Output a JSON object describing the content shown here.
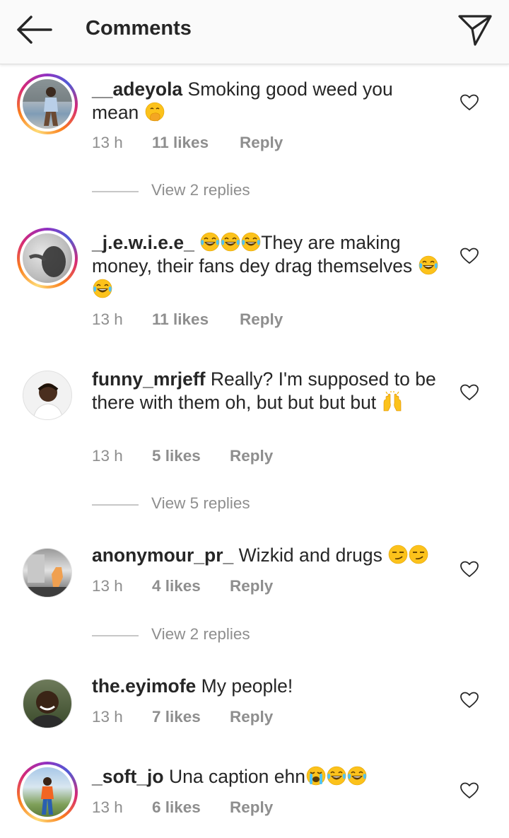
{
  "header": {
    "title": "Comments",
    "back_icon": "arrow-left-icon",
    "direct_icon": "paper-plane-icon"
  },
  "comments": [
    {
      "username": "__adeyola",
      "text": "Smoking good weed you mean",
      "emojis": [
        "face-with-hand-over-mouth"
      ],
      "time": "13 h",
      "likes": "11 likes",
      "reply": "Reply",
      "view_replies": "View 2 replies",
      "story_ring": true
    },
    {
      "username": "_j.e.w.i.e.e_",
      "text_before": "They are making money, their fans dey drag themselves",
      "emojis_before": [
        "tears-of-joy",
        "tears-of-joy",
        "tears-of-joy"
      ],
      "emojis_after": [
        "tears-of-joy",
        "tears-of-joy"
      ],
      "time": "13 h",
      "likes": "11 likes",
      "reply": "Reply",
      "story_ring": true
    },
    {
      "username": "funny_mrjeff",
      "text": "Really? I'm supposed to be there with them oh, but but but but",
      "emojis": [
        "raising-hands"
      ],
      "time": "13 h",
      "likes": "5 likes",
      "reply": "Reply",
      "view_replies": "View 5 replies",
      "story_ring": false
    },
    {
      "username": "anonymour_pr_",
      "text": "Wizkid and drugs",
      "emojis": [
        "smirking-face",
        "smirking-face"
      ],
      "time": "13 h",
      "likes": "4 likes",
      "reply": "Reply",
      "view_replies": "View 2 replies",
      "story_ring": false
    },
    {
      "username": "the.eyimofe",
      "text": "My people!",
      "time": "13 h",
      "likes": "7 likes",
      "reply": "Reply",
      "story_ring": false
    },
    {
      "username": "_soft_jo",
      "text": "Una caption ehn",
      "emojis": [
        "loudly-crying",
        "tears-of-joy",
        "tears-of-joy"
      ],
      "time": "13 h",
      "likes": "6 likes",
      "reply": "Reply",
      "story_ring": true
    }
  ],
  "colors": {
    "text": "#262626",
    "secondary": "#8e8e8e",
    "divider": "#c7c7c7",
    "header_bg": "#fafafa"
  }
}
